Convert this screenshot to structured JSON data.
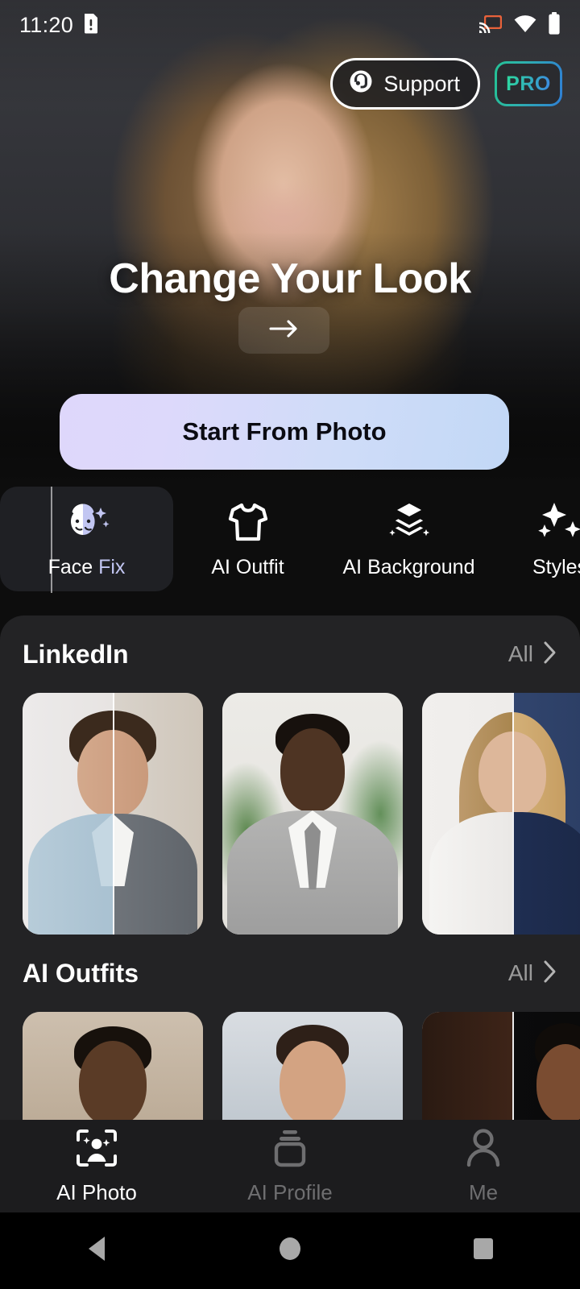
{
  "status_bar": {
    "time": "11:20",
    "icons": [
      "sim-alert-icon",
      "cast-icon",
      "wifi-icon",
      "battery-icon"
    ],
    "cast_color": "#e8623a"
  },
  "top_actions": {
    "support_label": "Support",
    "support_icon": "headset-support-icon",
    "pro_label": "PRO",
    "pro_gradient_from": "#2ddc9e",
    "pro_gradient_to": "#3d86e6"
  },
  "hero": {
    "title": "Change Your Look",
    "arrow_icon": "arrow-right-icon"
  },
  "cta": {
    "label": "Start From Photo",
    "gradient_from": "#ded7fb",
    "gradient_to": "#c2d8f6"
  },
  "feature_tabs": {
    "selected_index": 0,
    "items": [
      {
        "label": "Face Fix",
        "label_a": "Face ",
        "label_b": "Fix",
        "icon": "face-sparkle-icon",
        "selected": true
      },
      {
        "label": "AI Outfit",
        "icon": "tshirt-icon",
        "selected": false
      },
      {
        "label": "AI Background",
        "icon": "layers-sparkle-icon",
        "selected": false
      },
      {
        "label": "Styles",
        "icon": "sparkles-icon",
        "selected": false
      }
    ]
  },
  "sections": [
    {
      "title": "LinkedIn",
      "all_label": "All",
      "chevron_icon": "chevron-right-icon",
      "cards": [
        {
          "name": "man-blue-shirt-to-grey-vest",
          "split": true
        },
        {
          "name": "man-grey-suit-plants",
          "split": false
        },
        {
          "name": "woman-white-top-to-navy-blazer",
          "split": true
        }
      ]
    },
    {
      "title": "AI Outfits",
      "all_label": "All",
      "chevron_icon": "chevron-right-icon",
      "cards": [
        {
          "name": "man-white-shirt-street",
          "split": false
        },
        {
          "name": "man-white-shirt-city",
          "split": false
        },
        {
          "name": "woman-neon-sign",
          "split": true
        }
      ]
    }
  ],
  "bottom_nav": {
    "items": [
      {
        "label": "AI Photo",
        "icon": "face-scan-icon",
        "active": true
      },
      {
        "label": "AI Profile",
        "icon": "cards-stack-icon",
        "active": false
      },
      {
        "label": "Me",
        "icon": "person-icon",
        "active": false
      }
    ]
  },
  "android_nav": {
    "back_icon": "triangle-back-icon",
    "home_icon": "circle-home-icon",
    "recents_icon": "square-recents-icon"
  }
}
